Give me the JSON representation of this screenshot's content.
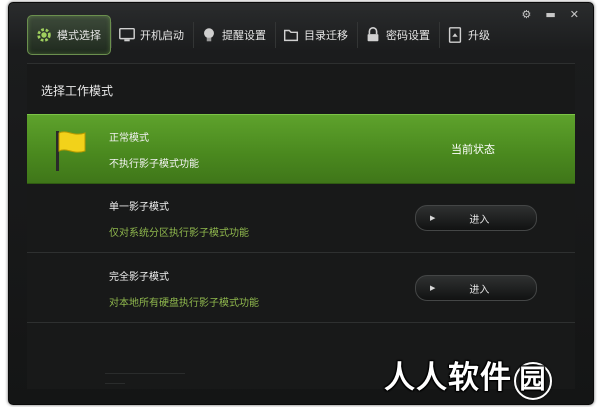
{
  "window": {
    "controls": {
      "settings": "⚙",
      "minimize": "▬",
      "close": "✕"
    }
  },
  "toolbar": {
    "tabs": [
      {
        "label": "模式选择",
        "icon": "gear-icon",
        "active": true
      },
      {
        "label": "开机启动",
        "icon": "monitor-icon",
        "active": false
      },
      {
        "label": "提醒设置",
        "icon": "lightbulb-icon",
        "active": false
      },
      {
        "label": "目录迁移",
        "icon": "folder-icon",
        "active": false
      },
      {
        "label": "密码设置",
        "icon": "lock-icon",
        "active": false
      },
      {
        "label": "升级",
        "icon": "upgrade-icon",
        "active": false
      }
    ]
  },
  "panel": {
    "title": "选择工作模式",
    "modes": [
      {
        "name": "正常模式",
        "desc": "不执行影子模式功能",
        "status": "当前状态",
        "icon": "flag-icon"
      },
      {
        "name": "单一影子模式",
        "desc": "仅对系统分区执行影子模式功能",
        "button": "进入"
      },
      {
        "name": "完全影子模式",
        "desc": "对本地所有硬盘执行影子模式功能",
        "button": "进入"
      }
    ]
  },
  "watermark": {
    "text": "人人软件",
    "circled": "园"
  },
  "colors": {
    "accent_green": "#5ea22c",
    "desc_green": "#8fb84d",
    "background": "#181919"
  }
}
